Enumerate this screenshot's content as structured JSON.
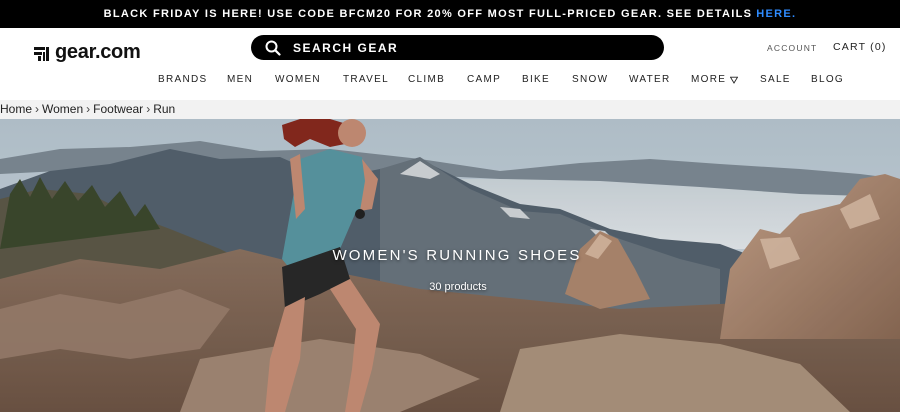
{
  "promo": {
    "text": "BLACK FRIDAY IS HERE! USE CODE BFCM20 FOR 20% OFF MOST FULL-PRICED GEAR. SEE DETAILS",
    "link": "HERE."
  },
  "header": {
    "logo": "gear.com",
    "search_placeholder": "SEARCH GEAR",
    "account": "ACCOUNT",
    "cart": "CART (0)"
  },
  "nav": {
    "items": [
      "BRANDS",
      "MEN",
      "WOMEN",
      "TRAVEL",
      "CLIMB",
      "CAMP",
      "BIKE",
      "SNOW",
      "WATER",
      "MORE",
      "SALE",
      "BLOG"
    ]
  },
  "breadcrumb": {
    "items": [
      "Home",
      "Women",
      "Footwear",
      "Run"
    ],
    "separator": "›"
  },
  "hero": {
    "title": "WOMEN'S RUNNING SHOES",
    "count": "30 products"
  },
  "colors": {
    "promo_link": "#2f8cff",
    "promo_bg": "#000000",
    "breadcrumb_bg": "#f2f2f2"
  },
  "icons": {
    "logo": "gear-logo-icon",
    "search": "search-icon",
    "more": "triangle-down-icon"
  }
}
